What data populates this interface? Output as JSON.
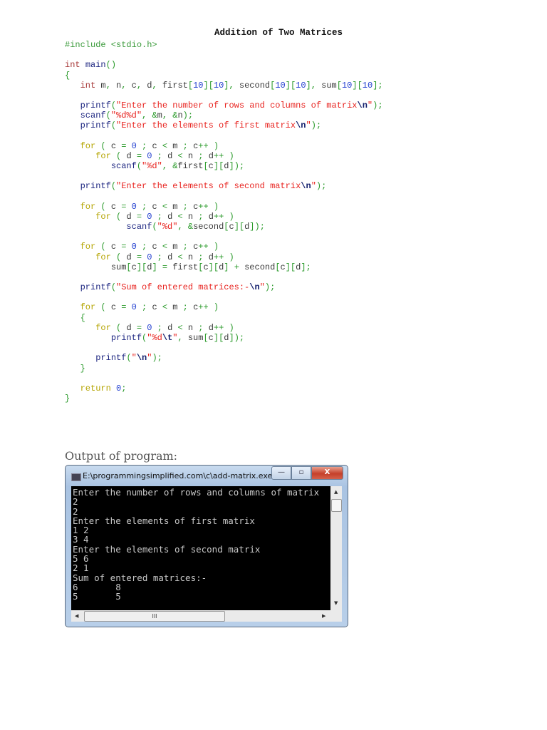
{
  "title": "Addition of Two Matrices",
  "code_lines": [
    "#include <stdio.h>",
    "",
    "int main()",
    "{",
    "   int m, n, c, d, first[10][10], second[10][10], sum[10][10];",
    "",
    "   printf(\"Enter the number of rows and columns of matrix\\n\");",
    "   scanf(\"%d%d\", &m, &n);",
    "   printf(\"Enter the elements of first matrix\\n\");",
    "",
    "   for ( c = 0 ; c < m ; c++ )",
    "      for ( d = 0 ; d < n ; d++ )",
    "         scanf(\"%d\", &first[c][d]);",
    "",
    "   printf(\"Enter the elements of second matrix\\n\");",
    "",
    "   for ( c = 0 ; c < m ; c++ )",
    "      for ( d = 0 ; d < n ; d++ )",
    "            scanf(\"%d\", &second[c][d]);",
    "",
    "   for ( c = 0 ; c < m ; c++ )",
    "      for ( d = 0 ; d < n ; d++ )",
    "         sum[c][d] = first[c][d] + second[c][d];",
    "",
    "   printf(\"Sum of entered matrices:-\\n\");",
    "",
    "   for ( c = 0 ; c < m ; c++ )",
    "   {",
    "      for ( d = 0 ; d < n ; d++ )",
    "         printf(\"%d\\t\", sum[c][d]);",
    "",
    "      printf(\"\\n\");",
    "   }",
    "",
    "   return 0;",
    "}"
  ],
  "output_label": "Output of program:",
  "window": {
    "title": "E:\\programmingsimplified.com\\c\\add-matrix.exe",
    "minimize": "—",
    "maximize": "▫",
    "close": "X",
    "console_lines": [
      "Enter the number of rows and columns of matrix",
      "2",
      "2",
      "Enter the elements of first matrix",
      "1 2",
      "3 4",
      "Enter the elements of second matrix",
      "5 6",
      "2 1",
      "Sum of entered matrices:-",
      "6       8",
      "5       5"
    ],
    "hscroll_grip": "III"
  }
}
